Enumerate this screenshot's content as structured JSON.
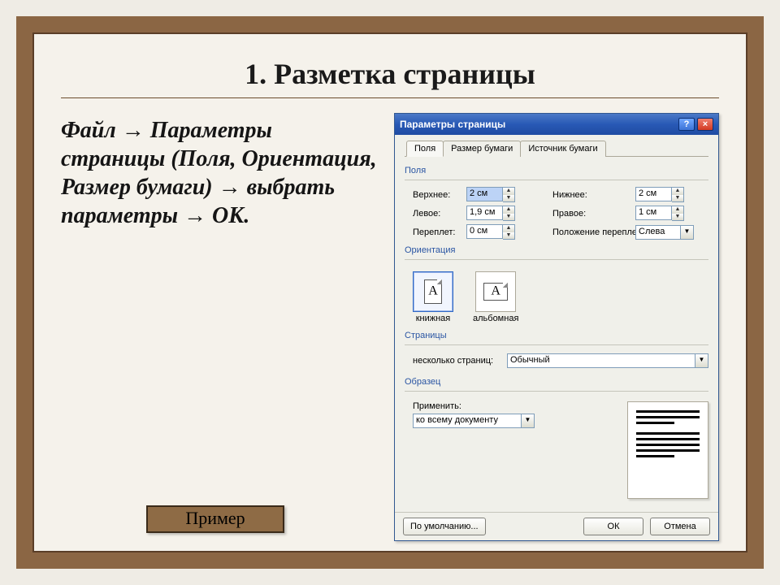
{
  "title": "1. Разметка страницы",
  "body_text": "Файл → Параметры страницы (Поля, Ориентация, Размер бумаги) → выбрать параметры → ОК.",
  "example_button": "Пример",
  "dialog": {
    "title": "Параметры страницы",
    "tabs": {
      "fields": "Поля",
      "paper": "Размер бумаги",
      "source": "Источник бумаги"
    },
    "groups": {
      "fields": "Поля",
      "orientation": "Ориентация",
      "pages": "Страницы",
      "sample": "Образец"
    },
    "labels": {
      "top": "Верхнее:",
      "bottom": "Нижнее:",
      "left": "Левое:",
      "right": "Правое:",
      "gutter": "Переплет:",
      "gutter_pos": "Положение переплета:",
      "portrait": "книжная",
      "landscape": "альбомная",
      "multi_pages": "несколько страниц:",
      "apply": "Применить:"
    },
    "values": {
      "top": "2 см",
      "bottom": "2 см",
      "left": "1,9 см",
      "right": "1 см",
      "gutter": "0 см",
      "gutter_pos": "Слева",
      "multi_pages": "Обычный",
      "apply": "ко всему документу"
    },
    "buttons": {
      "default": "По умолчанию...",
      "ok": "ОК",
      "cancel": "Отмена"
    }
  }
}
